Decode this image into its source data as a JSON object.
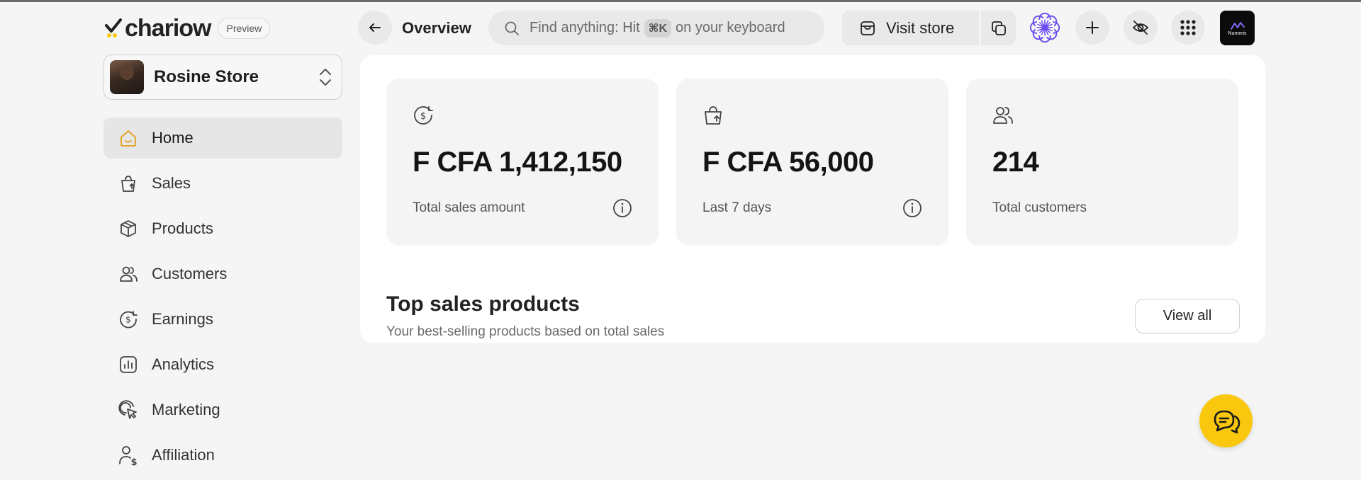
{
  "brand": {
    "name": "chariow",
    "preview_label": "Preview"
  },
  "store": {
    "name": "Rosine Store"
  },
  "sidebar": {
    "items": [
      {
        "label": "Home",
        "icon": "home-icon",
        "active": true
      },
      {
        "label": "Sales",
        "icon": "shopping-bag-icon"
      },
      {
        "label": "Products",
        "icon": "box-icon"
      },
      {
        "label": "Customers",
        "icon": "users-icon"
      },
      {
        "label": "Earnings",
        "icon": "coin-icon"
      },
      {
        "label": "Analytics",
        "icon": "chart-icon"
      },
      {
        "label": "Marketing",
        "icon": "cursor-click-icon"
      },
      {
        "label": "Affiliation",
        "icon": "user-dollar-icon"
      }
    ]
  },
  "header": {
    "title": "Overview",
    "search": {
      "prefix": "Find anything: Hit",
      "shortcut": "⌘K",
      "suffix": "on your keyboard"
    },
    "visit_store_label": "Visit store",
    "account_badge": "Numeris"
  },
  "stats": [
    {
      "value": "F CFA 1,412,150",
      "label": "Total sales amount",
      "icon": "coin-icon",
      "info": true
    },
    {
      "value": "F CFA 56,000",
      "label": "Last 7 days",
      "icon": "shopping-bag-icon",
      "info": true
    },
    {
      "value": "214",
      "label": "Total customers",
      "icon": "users-icon",
      "info": false
    }
  ],
  "top_sales": {
    "title": "Top sales products",
    "subtitle": "Your best-selling products based on total sales",
    "view_all_label": "View all"
  },
  "colors": {
    "accent": "#f9c80e",
    "home_icon": "#e5a52a",
    "sparkle": "#6a4cf0",
    "page_bg": "#f5f5f5"
  }
}
